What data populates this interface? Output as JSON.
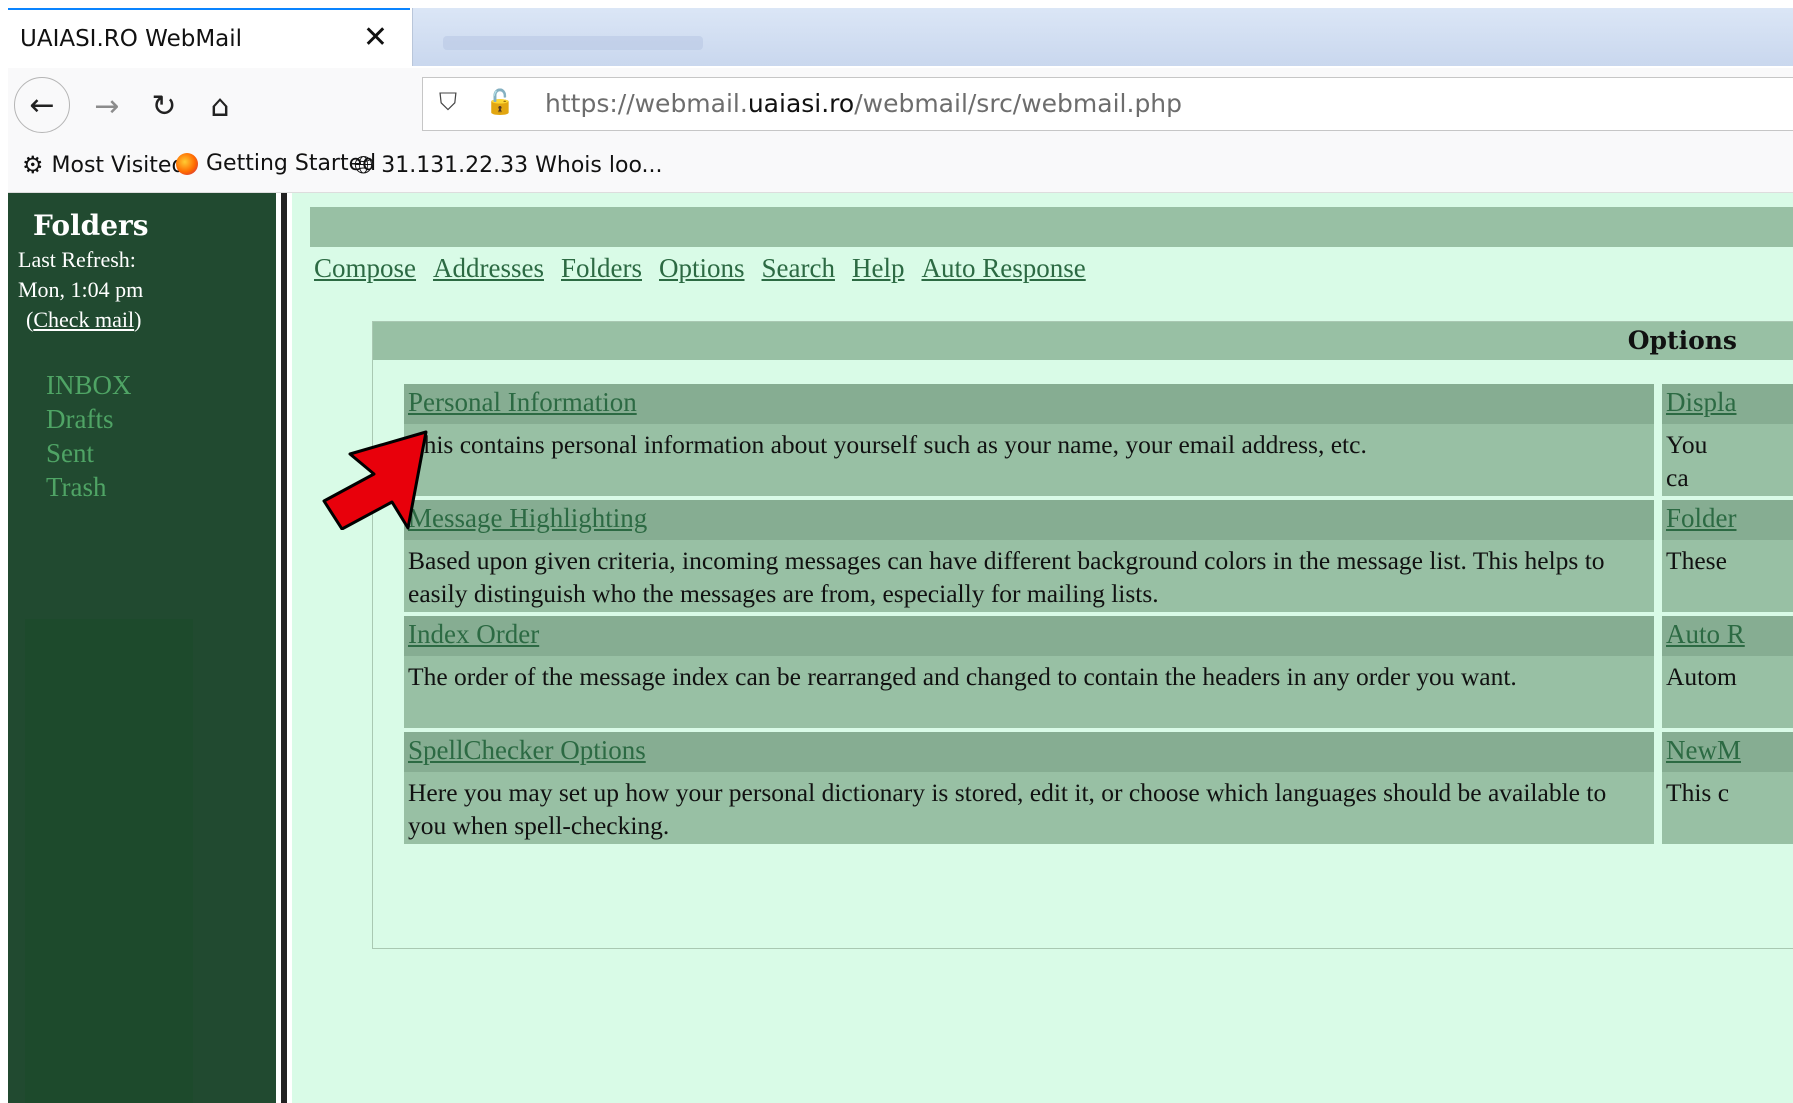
{
  "browser": {
    "tab_title": "UAIASI.RO WebMail",
    "close_glyph": "✕",
    "url_prefix": "https://webmail.",
    "url_domain": "uaiasi.ro",
    "url_path": "/webmail/src/webmail.php",
    "bookmarks": [
      {
        "icon": "gear-icon",
        "label": "Most Visited"
      },
      {
        "icon": "firefox-icon",
        "label": "Getting Started"
      },
      {
        "icon": "globe-icon",
        "label": "31.131.22.33 Whois loo..."
      }
    ]
  },
  "sidebar": {
    "title": "Folders",
    "refresh_label": "Last Refresh:",
    "refresh_time": "Mon, 1:04 pm",
    "check_mail": "Check mail",
    "folders": [
      "INBOX",
      "Drafts",
      "Sent",
      "Trash"
    ]
  },
  "menu": [
    "Compose",
    "Addresses",
    "Folders",
    "Options",
    "Search",
    "Help",
    "Auto Response"
  ],
  "options": {
    "title": "Options",
    "left": [
      {
        "label": "Personal Information",
        "desc": "This contains personal information about yourself such as your name, your email address, etc."
      },
      {
        "label": "Message Highlighting",
        "desc": "Based upon given criteria, incoming messages can have different background colors in the message list. This helps to easily distinguish who the messages are from, especially for mailing lists."
      },
      {
        "label": "Index Order",
        "desc": "The order of the message index can be rearranged and changed to contain the headers in any order you want."
      },
      {
        "label": "SpellChecker Options",
        "desc": "Here you may set up how your personal dictionary is stored, edit it, or choose which languages should be available to you when spell-checking."
      }
    ],
    "right": [
      {
        "label": "Displa",
        "desc": "You ca langua"
      },
      {
        "label": "Folder",
        "desc": "These"
      },
      {
        "label": "Auto R",
        "desc": "Autom"
      },
      {
        "label": "NewM",
        "desc": "This c"
      }
    ]
  },
  "colors": {
    "sidebar_bg": "#214a30",
    "page_bg": "#d9fbe7",
    "bar_bg": "#98c0a4",
    "link": "#2c6a43",
    "folder_link": "#4fa465",
    "arrow": "#e8000b"
  }
}
